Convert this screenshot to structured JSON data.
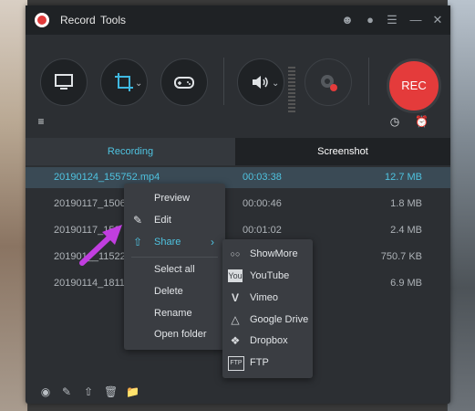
{
  "menu": {
    "record": "Record",
    "tools": "Tools"
  },
  "tabs": {
    "recording": "Recording",
    "screenshot": "Screenshot"
  },
  "rec_button": "REC",
  "files": [
    {
      "name": "20190124_155752.mp4",
      "duration": "00:03:38",
      "size": "12.7 MB"
    },
    {
      "name": "20190117_150601",
      "duration": "00:00:46",
      "size": "1.8 MB"
    },
    {
      "name": "20190117_150",
      "duration": "00:01:02",
      "size": "2.4 MB"
    },
    {
      "name": "201901__115228",
      "duration": "",
      "size": "750.7 KB"
    },
    {
      "name": "20190114_181146",
      "duration": "",
      "size": "6.9 MB"
    }
  ],
  "context_menu": {
    "preview": "Preview",
    "edit": "Edit",
    "share": "Share",
    "select_all": "Select all",
    "delete": "Delete",
    "rename": "Rename",
    "open_folder": "Open folder"
  },
  "share_menu": [
    {
      "label": "ShowMore",
      "icon": "showmore-icon"
    },
    {
      "label": "YouTube",
      "icon": "youtube-icon"
    },
    {
      "label": "Vimeo",
      "icon": "vimeo-icon"
    },
    {
      "label": "Google Drive",
      "icon": "google-drive-icon"
    },
    {
      "label": "Dropbox",
      "icon": "dropbox-icon"
    },
    {
      "label": "FTP",
      "icon": "ftp-icon"
    }
  ],
  "colors": {
    "accent": "#4fc3e0",
    "rec": "#e43b3b",
    "arrow": "#c13ee0"
  }
}
